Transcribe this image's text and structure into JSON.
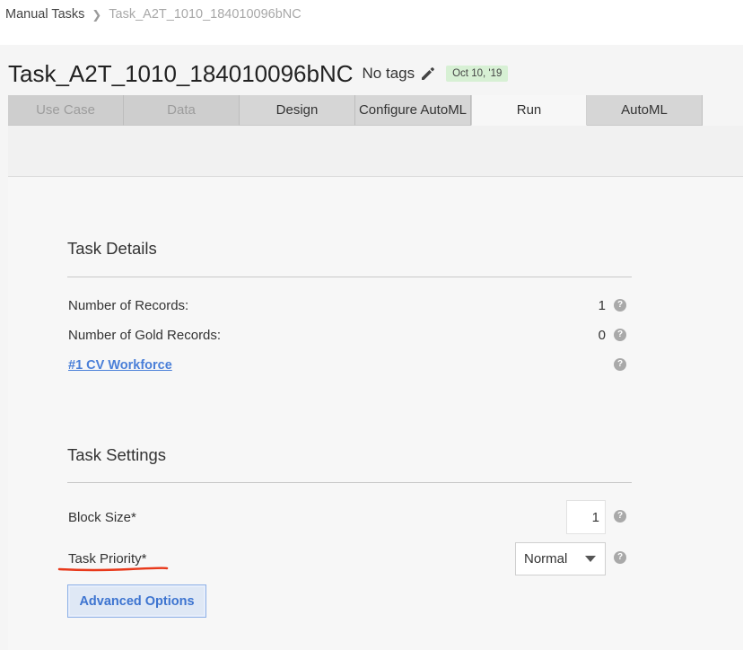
{
  "breadcrumb": {
    "parent": "Manual Tasks",
    "separator": ">",
    "current": "Task_A2T_1010_184010096bNC"
  },
  "header": {
    "title": "Task_A2T_1010_184010096bNC",
    "tags_label": "No tags",
    "date_badge": "Oct 10, '19",
    "edit_icon": "pencil-icon"
  },
  "tabs": [
    {
      "label": "Use Case",
      "state": "disabled"
    },
    {
      "label": "Data",
      "state": "disabled"
    },
    {
      "label": "Design",
      "state": "normal"
    },
    {
      "label": "Configure AutoML",
      "state": "normal"
    },
    {
      "label": "Run",
      "state": "active"
    },
    {
      "label": "AutoML",
      "state": "normal"
    }
  ],
  "task_details": {
    "title": "Task Details",
    "rows": [
      {
        "label": "Number of Records:",
        "value": "1"
      },
      {
        "label": "Number of Gold Records:",
        "value": "0"
      },
      {
        "label": "#1 CV Workforce",
        "value": ""
      }
    ]
  },
  "task_settings": {
    "title": "Task Settings",
    "block_size_label": "Block Size*",
    "block_size_value": "1",
    "priority_label": "Task Priority*",
    "priority_value": "Normal",
    "advanced_label": "Advanced Options"
  },
  "colors": {
    "badge_bg": "#d7f0d4",
    "link": "#4a7fd8",
    "annotation": "#e8391b",
    "active_tab": "#f7f7f7"
  }
}
